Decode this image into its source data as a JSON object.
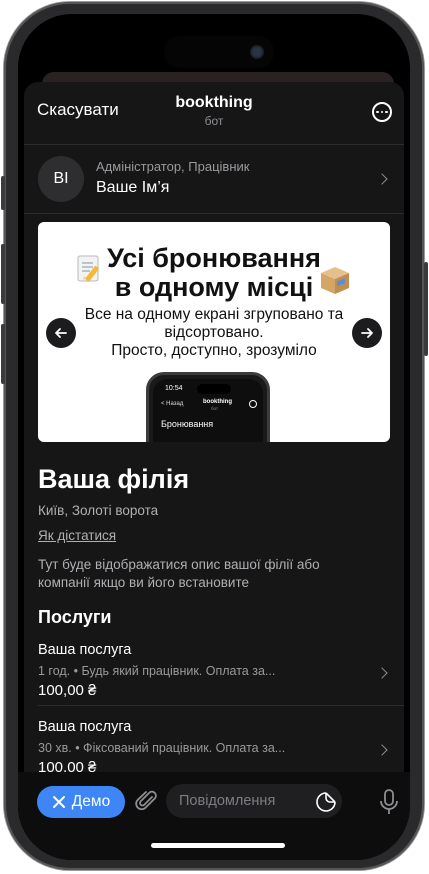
{
  "header": {
    "cancel_label": "Скасувати",
    "title": "bookthing",
    "subtitle": "бот",
    "more_icon": "more-circle-icon"
  },
  "profile": {
    "initials": "ВІ",
    "role": "Адміністратор, Працівник",
    "name": "Ваше Ім’я"
  },
  "banner": {
    "title_line1": "Усі бронювання",
    "title_line2": "в одному місці",
    "text_line1": "Все на одному екрані згруповано та",
    "text_line2": "відсортовано.",
    "text_line3": "Просто, доступно, зрозуміло",
    "mini_phone": {
      "time": "10:54",
      "back": "< Назад",
      "brand": "bookthing",
      "brand_sub": "бот",
      "heading": "Бронювання"
    }
  },
  "branch": {
    "title": "Ваша філія",
    "address": "Київ, Золоті ворота",
    "directions_link": "Як дістатися",
    "description": "Тут буде відображатися опис вашої філії або компанії якщо ви його встановите"
  },
  "services": {
    "title": "Послуги",
    "items": [
      {
        "name": "Ваша послуга",
        "meta": "1 год. • Будь який працівник. Оплата за...",
        "price": "100,00 ₴"
      },
      {
        "name": "Ваша послуга",
        "meta": "30 хв. • Фіксований працівник. Оплата за...",
        "price": "100,00 ₴"
      }
    ]
  },
  "composer": {
    "demo_label": "Демо",
    "message_placeholder": "Повідомлення"
  },
  "colors": {
    "accent": "#3e86f5",
    "sheet_bg": "#161616",
    "banner_bg": "#ffffff"
  }
}
